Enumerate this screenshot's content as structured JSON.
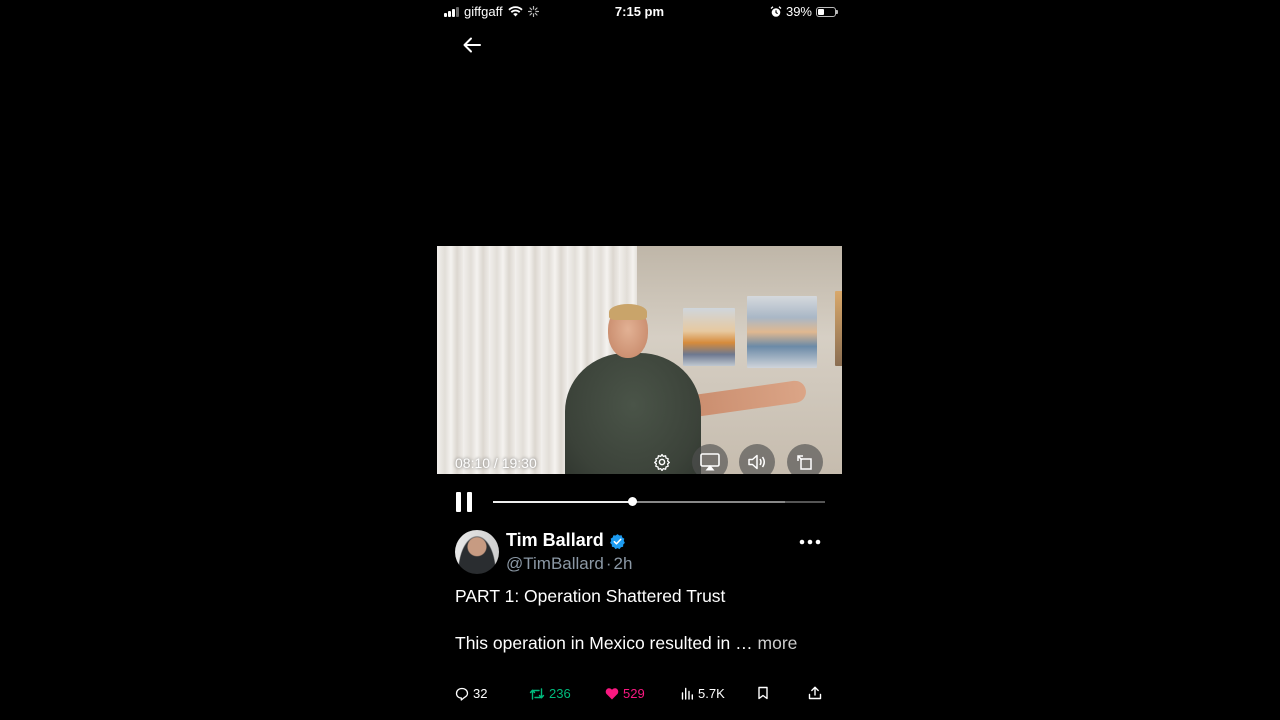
{
  "status_bar": {
    "carrier": "giffgaff",
    "time": "7:15 pm",
    "battery": "39%",
    "battery_level": 0.39
  },
  "video": {
    "time_display": "08:10 / 19:30",
    "elapsed": "08:10",
    "duration": "19:30",
    "progress_fraction": 0.419,
    "buffered_fraction": 0.88,
    "controls": [
      "settings-icon",
      "airplay-icon",
      "volume-icon",
      "rotate-icon"
    ]
  },
  "tweet": {
    "author_name": "Tim Ballard",
    "handle": "@TimBallard",
    "separator": "·",
    "age": "2h",
    "line1": "PART 1:  Operation Shattered Trust",
    "line2": "This operation in Mexico resulted in …",
    "more_label": "more"
  },
  "actions": {
    "replies": "32",
    "reposts": "236",
    "likes": "529",
    "views": "5.7K"
  },
  "colors": {
    "background": "#000000",
    "secondary_text": "#8b98a5",
    "verified_blue": "#1d9bf0",
    "repost_green": "#00ba7c",
    "like_pink": "#f91880"
  }
}
